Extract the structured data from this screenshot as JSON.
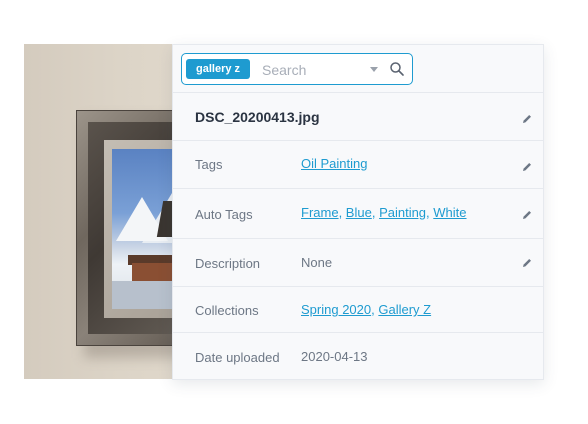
{
  "search": {
    "chip_label": "gallery z",
    "placeholder": "Search",
    "value": ""
  },
  "file": {
    "name": "DSC_20200413.jpg"
  },
  "fields": {
    "tags": {
      "label": "Tags",
      "items": [
        "Oil Painting"
      ]
    },
    "auto_tags": {
      "label": "Auto Tags",
      "items": [
        "Frame",
        "Blue",
        "Painting",
        "White"
      ]
    },
    "description": {
      "label": "Description",
      "value": "None"
    },
    "collections": {
      "label": "Collections",
      "items": [
        "Spring 2020",
        "Gallery Z"
      ]
    },
    "date_uploaded": {
      "label": "Date uploaded",
      "value": "2020-04-13"
    }
  },
  "icons": {
    "edit": "pencil-icon",
    "search": "search-icon",
    "dropdown": "chevron-down-icon"
  },
  "colors": {
    "accent": "#1e9bd0",
    "label": "#6d7785",
    "title": "#2b3442",
    "card_bg": "#f8f9fb"
  }
}
